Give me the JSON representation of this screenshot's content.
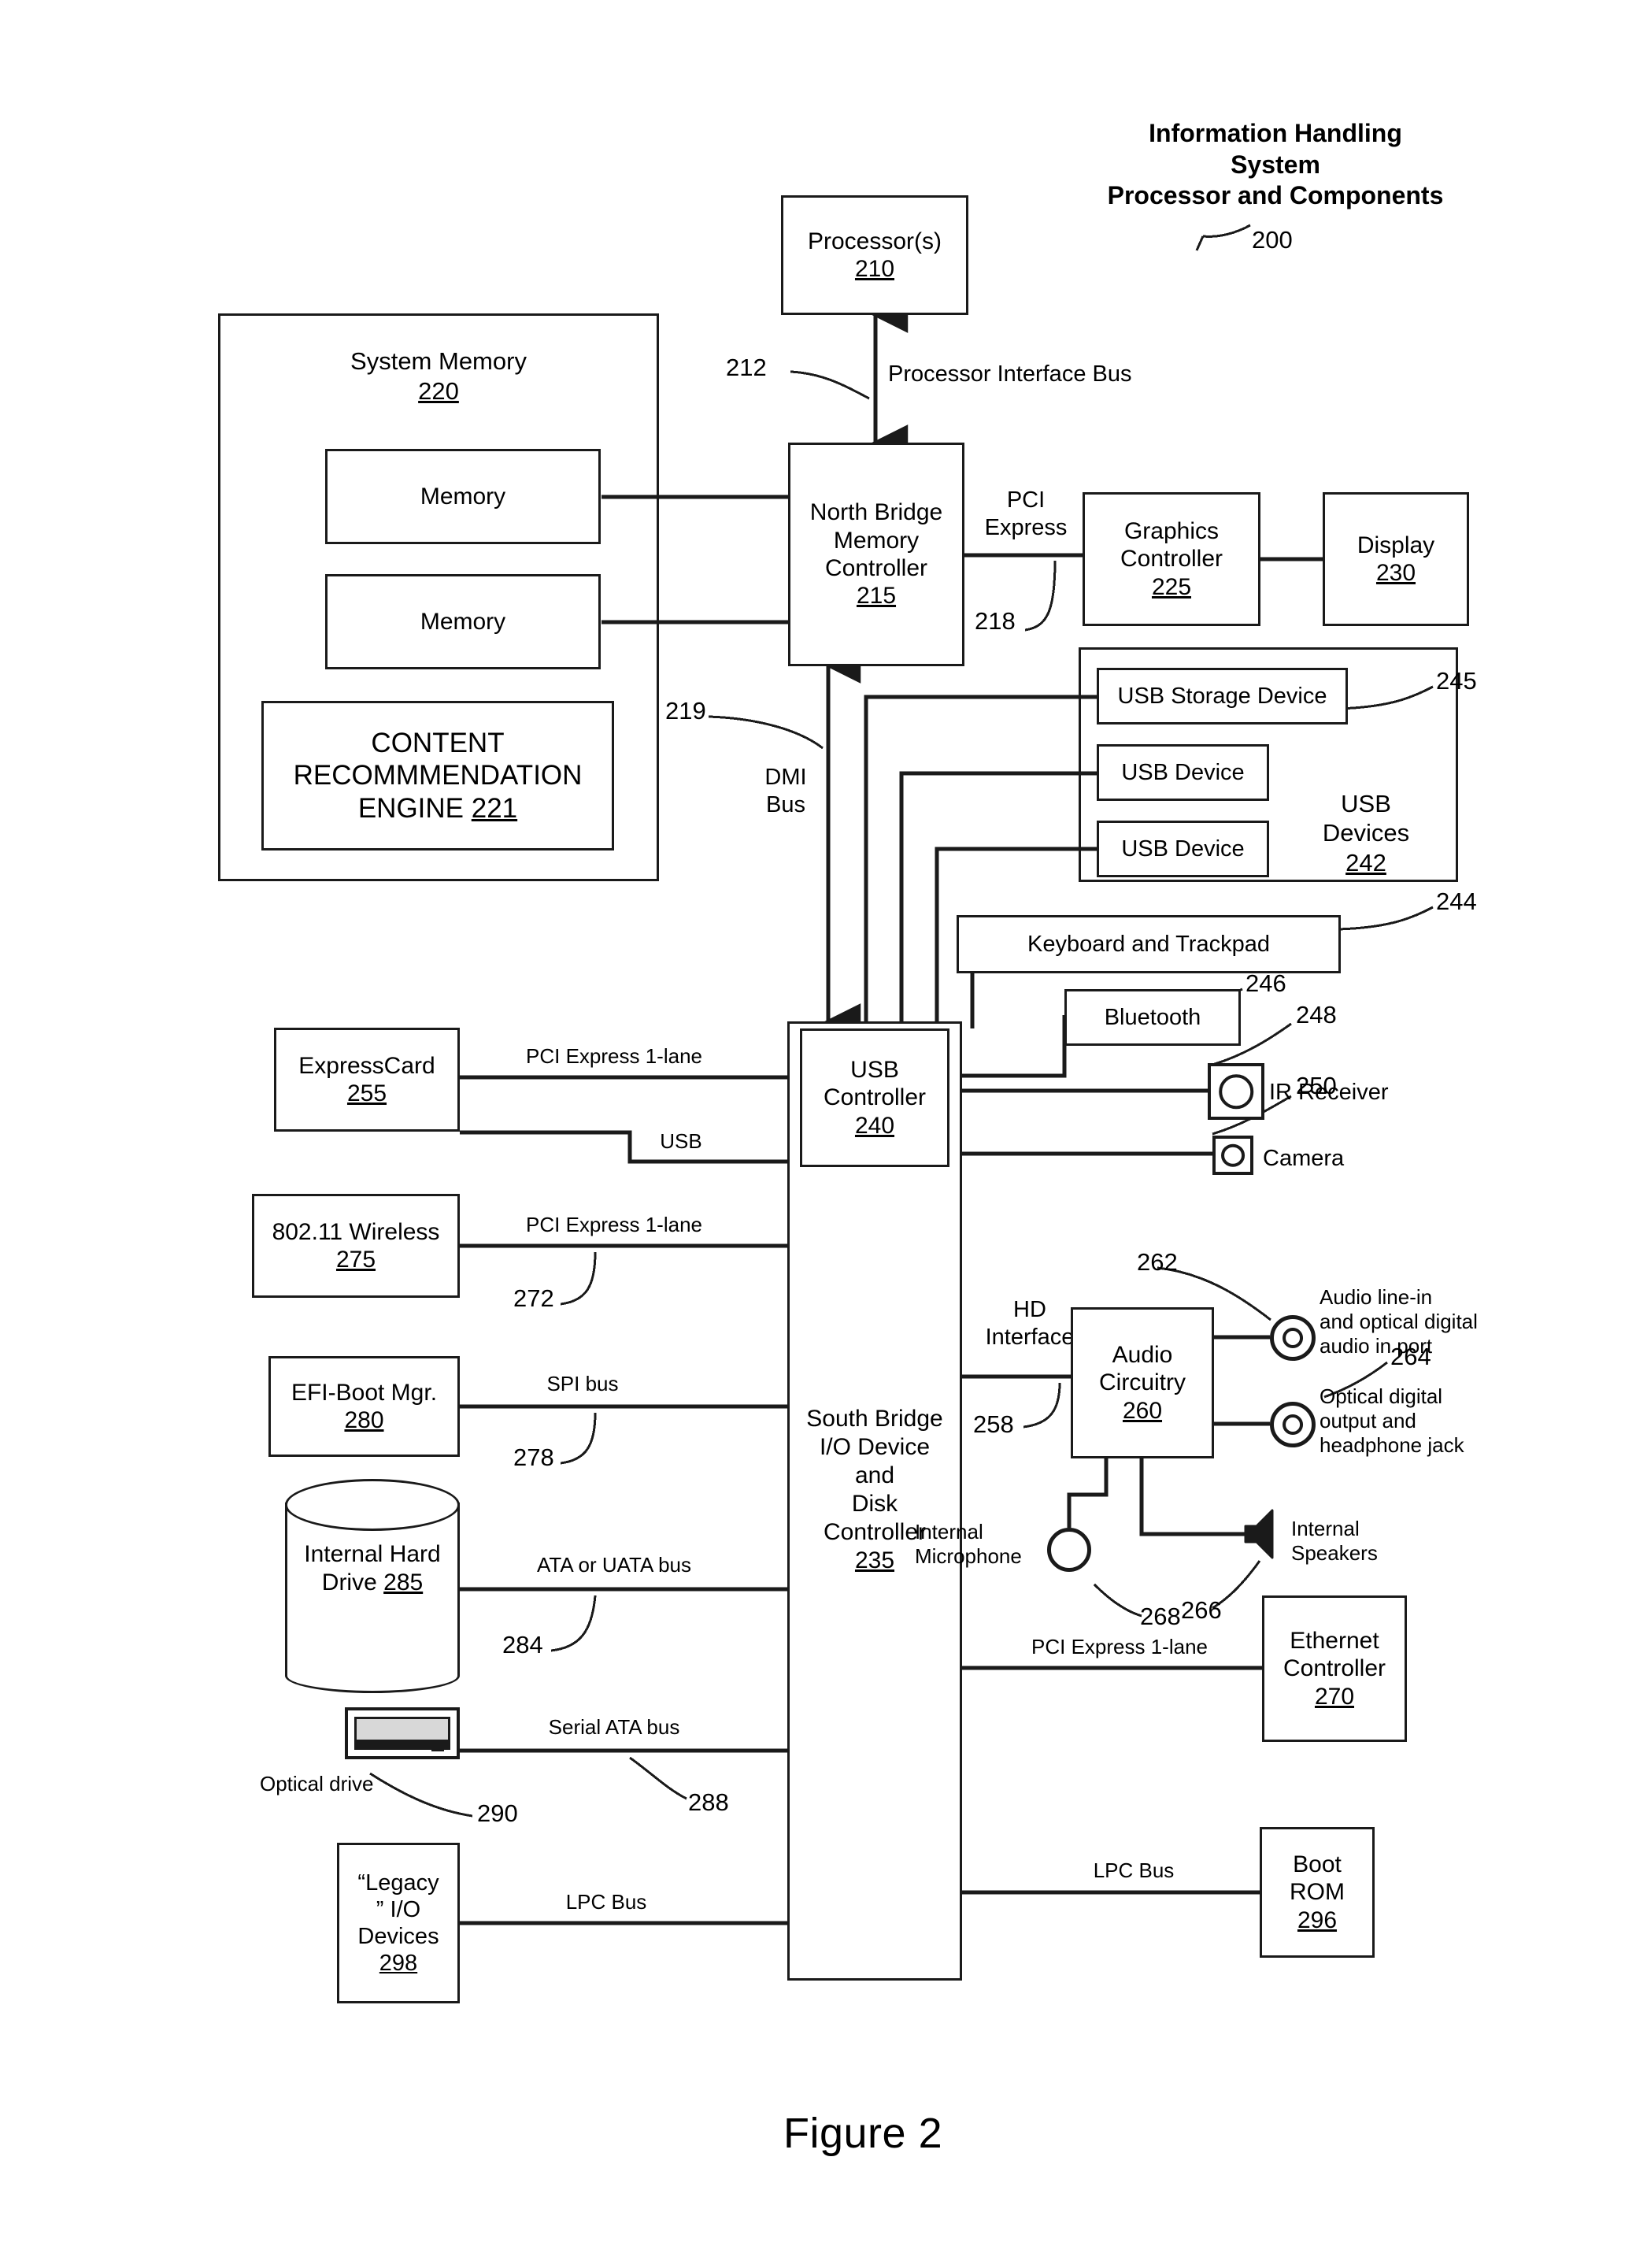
{
  "figure": {
    "caption": "Figure 2",
    "title": "Information Handling\nSystem\nProcessor and Components",
    "title_ref": "200"
  },
  "nodes": {
    "processor": {
      "line1": "Processor(s)",
      "ref": "210"
    },
    "system_memory": {
      "label": "System Memory",
      "ref": "220"
    },
    "memory_1": {
      "label": "Memory"
    },
    "memory_2": {
      "label": "Memory"
    },
    "content_engine": {
      "line1": "CONTENT",
      "line2": "RECOMMMENDATION",
      "line3": "ENGINE ",
      "ref": "221"
    },
    "north_bridge": {
      "line1": "North Bridge",
      "line2": "Memory",
      "line3": "Controller",
      "ref": "215"
    },
    "graphics_controller": {
      "line1": "Graphics",
      "line2": "Controller",
      "ref": "225"
    },
    "display": {
      "line1": "Display",
      "ref": "230"
    },
    "usb_storage_device": {
      "label": "USB Storage Device"
    },
    "usb_device_1": {
      "label": "USB Device"
    },
    "usb_device_2": {
      "label": "USB Device"
    },
    "usb_devices_group": {
      "line1": "USB",
      "line2": "Devices",
      "ref": "242"
    },
    "keyboard_trackpad": {
      "label": "Keyboard and Trackpad"
    },
    "bluetooth": {
      "label": "Bluetooth"
    },
    "ir_receiver": {
      "label": "IR Receiver"
    },
    "camera": {
      "label": "Camera"
    },
    "expresscard": {
      "line1": "ExpressCard",
      "ref": "255"
    },
    "wireless": {
      "line1": "802.11 Wireless",
      "ref": "275"
    },
    "efi_boot_mgr": {
      "line1": "EFI-Boot Mgr.",
      "ref": "280"
    },
    "internal_hard_drive": {
      "line1": "Internal",
      "line2": "Hard Drive",
      "ref": "285"
    },
    "optical_drive": {
      "label": "Optical drive"
    },
    "legacy_io": {
      "line1": "“Legacy",
      "line2": "” I/O",
      "line3": "Devices",
      "ref": "298"
    },
    "usb_controller": {
      "line1": "USB",
      "line2": "Controller",
      "ref": "240"
    },
    "south_bridge": {
      "line1": "South Bridge",
      "line2": "I/O Device",
      "line3": "and",
      "line4": "Disk",
      "line5": "Controller",
      "ref": "235"
    },
    "audio_circuitry": {
      "line1": "Audio",
      "line2": "Circuitry",
      "ref": "260"
    },
    "ethernet_controller": {
      "line1": "Ethernet",
      "line2": "Controller",
      "ref": "270"
    },
    "boot_rom": {
      "line1": "Boot",
      "line2": "ROM",
      "ref": "296"
    }
  },
  "bus_labels": {
    "processor_interface_bus": "Processor Interface Bus",
    "pci_express": "PCI\nExpress",
    "dmi_bus": "DMI\nBus",
    "pcie_1lane_expresscard": "PCI Express 1-lane",
    "usb": "USB",
    "pcie_1lane_wireless": "PCI Express 1-lane",
    "spi_bus": "SPI bus",
    "ata_uata_bus": "ATA or UATA bus",
    "serial_ata_bus": "Serial ATA bus",
    "lpc_bus_left": "LPC Bus",
    "lpc_bus_right": "LPC Bus",
    "hd_interface": "HD\nInterface",
    "pcie_1lane_ethernet": "PCI Express 1-lane"
  },
  "peripheral_labels": {
    "audio_line_in": "Audio line-in\nand optical digital\naudio in port",
    "optical_out": "Optical digital\noutput and\nheadphone jack",
    "internal_microphone": "Internal\nMicrophone",
    "internal_speakers": "Internal\nSpeakers"
  },
  "refs": {
    "r212": "212",
    "r218": "218",
    "r219": "219",
    "r244": "244",
    "r245": "245",
    "r246": "246",
    "r248": "248",
    "r250": "250",
    "r258": "258",
    "r262": "262",
    "r264": "264",
    "r266": "266",
    "r268": "268",
    "r272": "272",
    "r278": "278",
    "r284": "284",
    "r288": "288",
    "r290": "290"
  },
  "colors": {
    "ink": "#1a1a1a",
    "paper": "#ffffff"
  }
}
